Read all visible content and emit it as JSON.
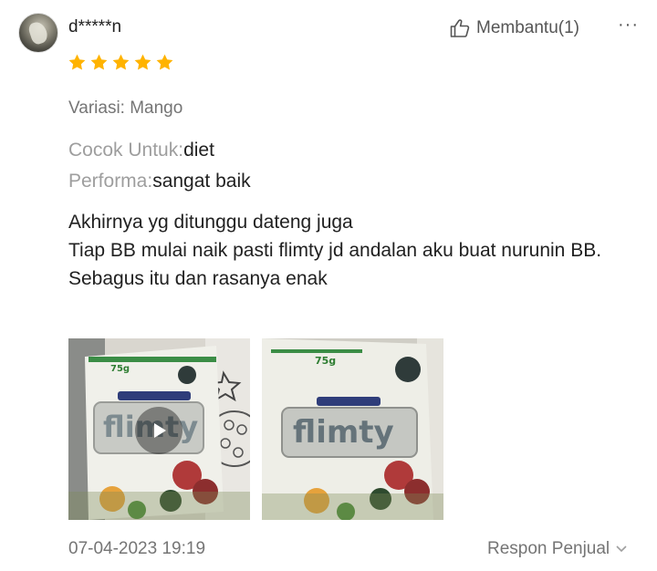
{
  "reviewer": {
    "name": "d*****n",
    "avatar_icon": "avatar-image"
  },
  "helpful": {
    "label": "Membantu(1)",
    "icon": "thumbs-up-icon"
  },
  "more_menu": {
    "label": "···"
  },
  "rating": {
    "stars": 5,
    "max": 5,
    "color": "#FFB300"
  },
  "variant": {
    "text": "Variasi: Mango"
  },
  "attributes": [
    {
      "key": "Cocok Untuk:",
      "value": "diet"
    },
    {
      "key": "Performa:",
      "value": "sangat baik"
    }
  ],
  "review_lines": [
    "Akhirnya yg ditunggu dateng juga",
    "Tiap BB mulai naik pasti flimty jd andalan aku buat nurunin BB.",
    "Sebagus itu dan rasanya enak"
  ],
  "media": [
    {
      "type": "video",
      "brand_text": "flimty",
      "weight_label": "75g",
      "icon": "play-icon"
    },
    {
      "type": "image",
      "brand_text": "flimty",
      "weight_label": "75g"
    }
  ],
  "date": "07-04-2023 19:19",
  "seller_response": {
    "label": "Respon Penjual",
    "icon": "chevron-down-icon"
  }
}
